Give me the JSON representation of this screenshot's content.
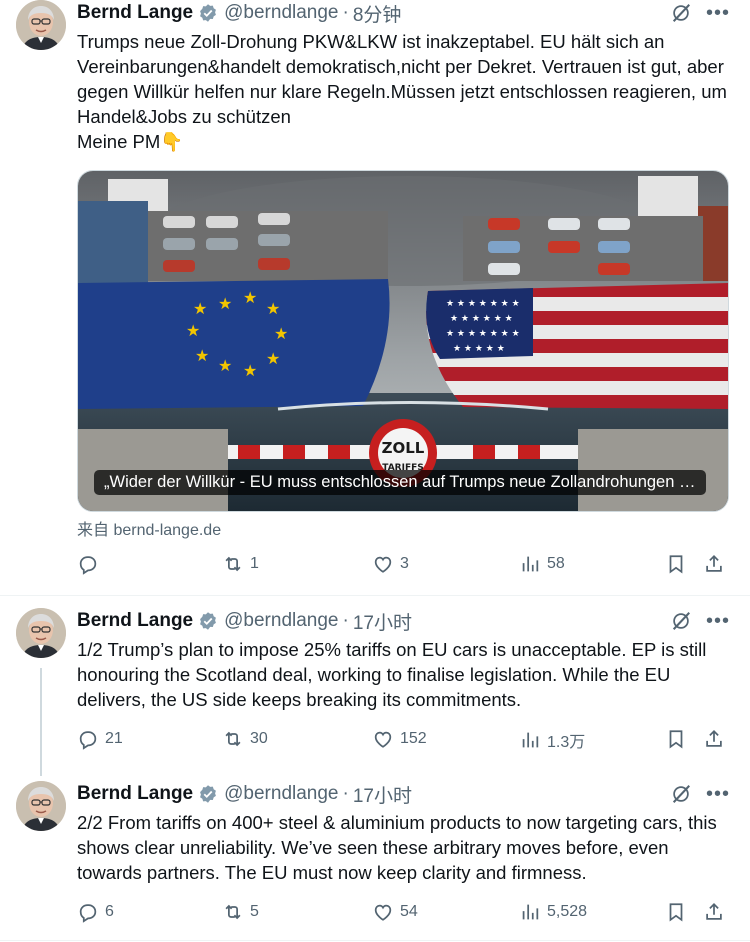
{
  "tweets": [
    {
      "name": "Bernd Lange",
      "handle": "@berndlange",
      "time": "8分钟",
      "text": "Trumps neue Zoll-Drohung PKW&LKW ist inakzeptabel. EU hält sich an Vereinbarungen&handelt demokratisch,nicht per Dekret. Vertrauen ist gut, aber gegen Willkür helfen nur klare Regeln.Müssen jetzt entschlossen reagieren, um Handel&Jobs zu schützen\nMeine PM👇",
      "card_caption": "„Wider der Willkür - EU muss entschlossen auf Trumps neue Zollandrohungen …",
      "card_sign": "ZOLL",
      "card_sign_sub": "TARIFFS",
      "source": "来自 bernd-lange.de",
      "stats": {
        "replies": "",
        "retweets": "1",
        "likes": "3",
        "views": "58"
      }
    },
    {
      "name": "Bernd Lange",
      "handle": "@berndlange",
      "time": "17小时",
      "text": "1/2 Trump’s plan to impose 25% tariffs on EU cars is unacceptable. EP is still honouring the Scotland deal, working to finalise legislation. While the EU delivers, the US side keeps breaking its commitments.",
      "stats": {
        "replies": "21",
        "retweets": "30",
        "likes": "152",
        "views": "1.3万"
      }
    },
    {
      "name": "Bernd Lange",
      "handle": "@berndlange",
      "time": "17小时",
      "text": "2/2 From tariffs on 400+ steel & aluminium products to now targeting cars, this shows clear unreliability. We’ve seen these arbitrary moves before, even towards partners. The EU must now keep clarity and firmness.",
      "stats": {
        "replies": "6",
        "retweets": "5",
        "likes": "54",
        "views": "5,528"
      }
    }
  ],
  "colors": {
    "text": "#0f1419",
    "muted": "#536471",
    "verified": "#829aab",
    "divider": "#eff3f4"
  },
  "icons": [
    "verified-badge-icon",
    "grok-icon",
    "more-icon",
    "reply-icon",
    "retweet-icon",
    "like-icon",
    "views-icon",
    "bookmark-icon",
    "share-icon"
  ]
}
